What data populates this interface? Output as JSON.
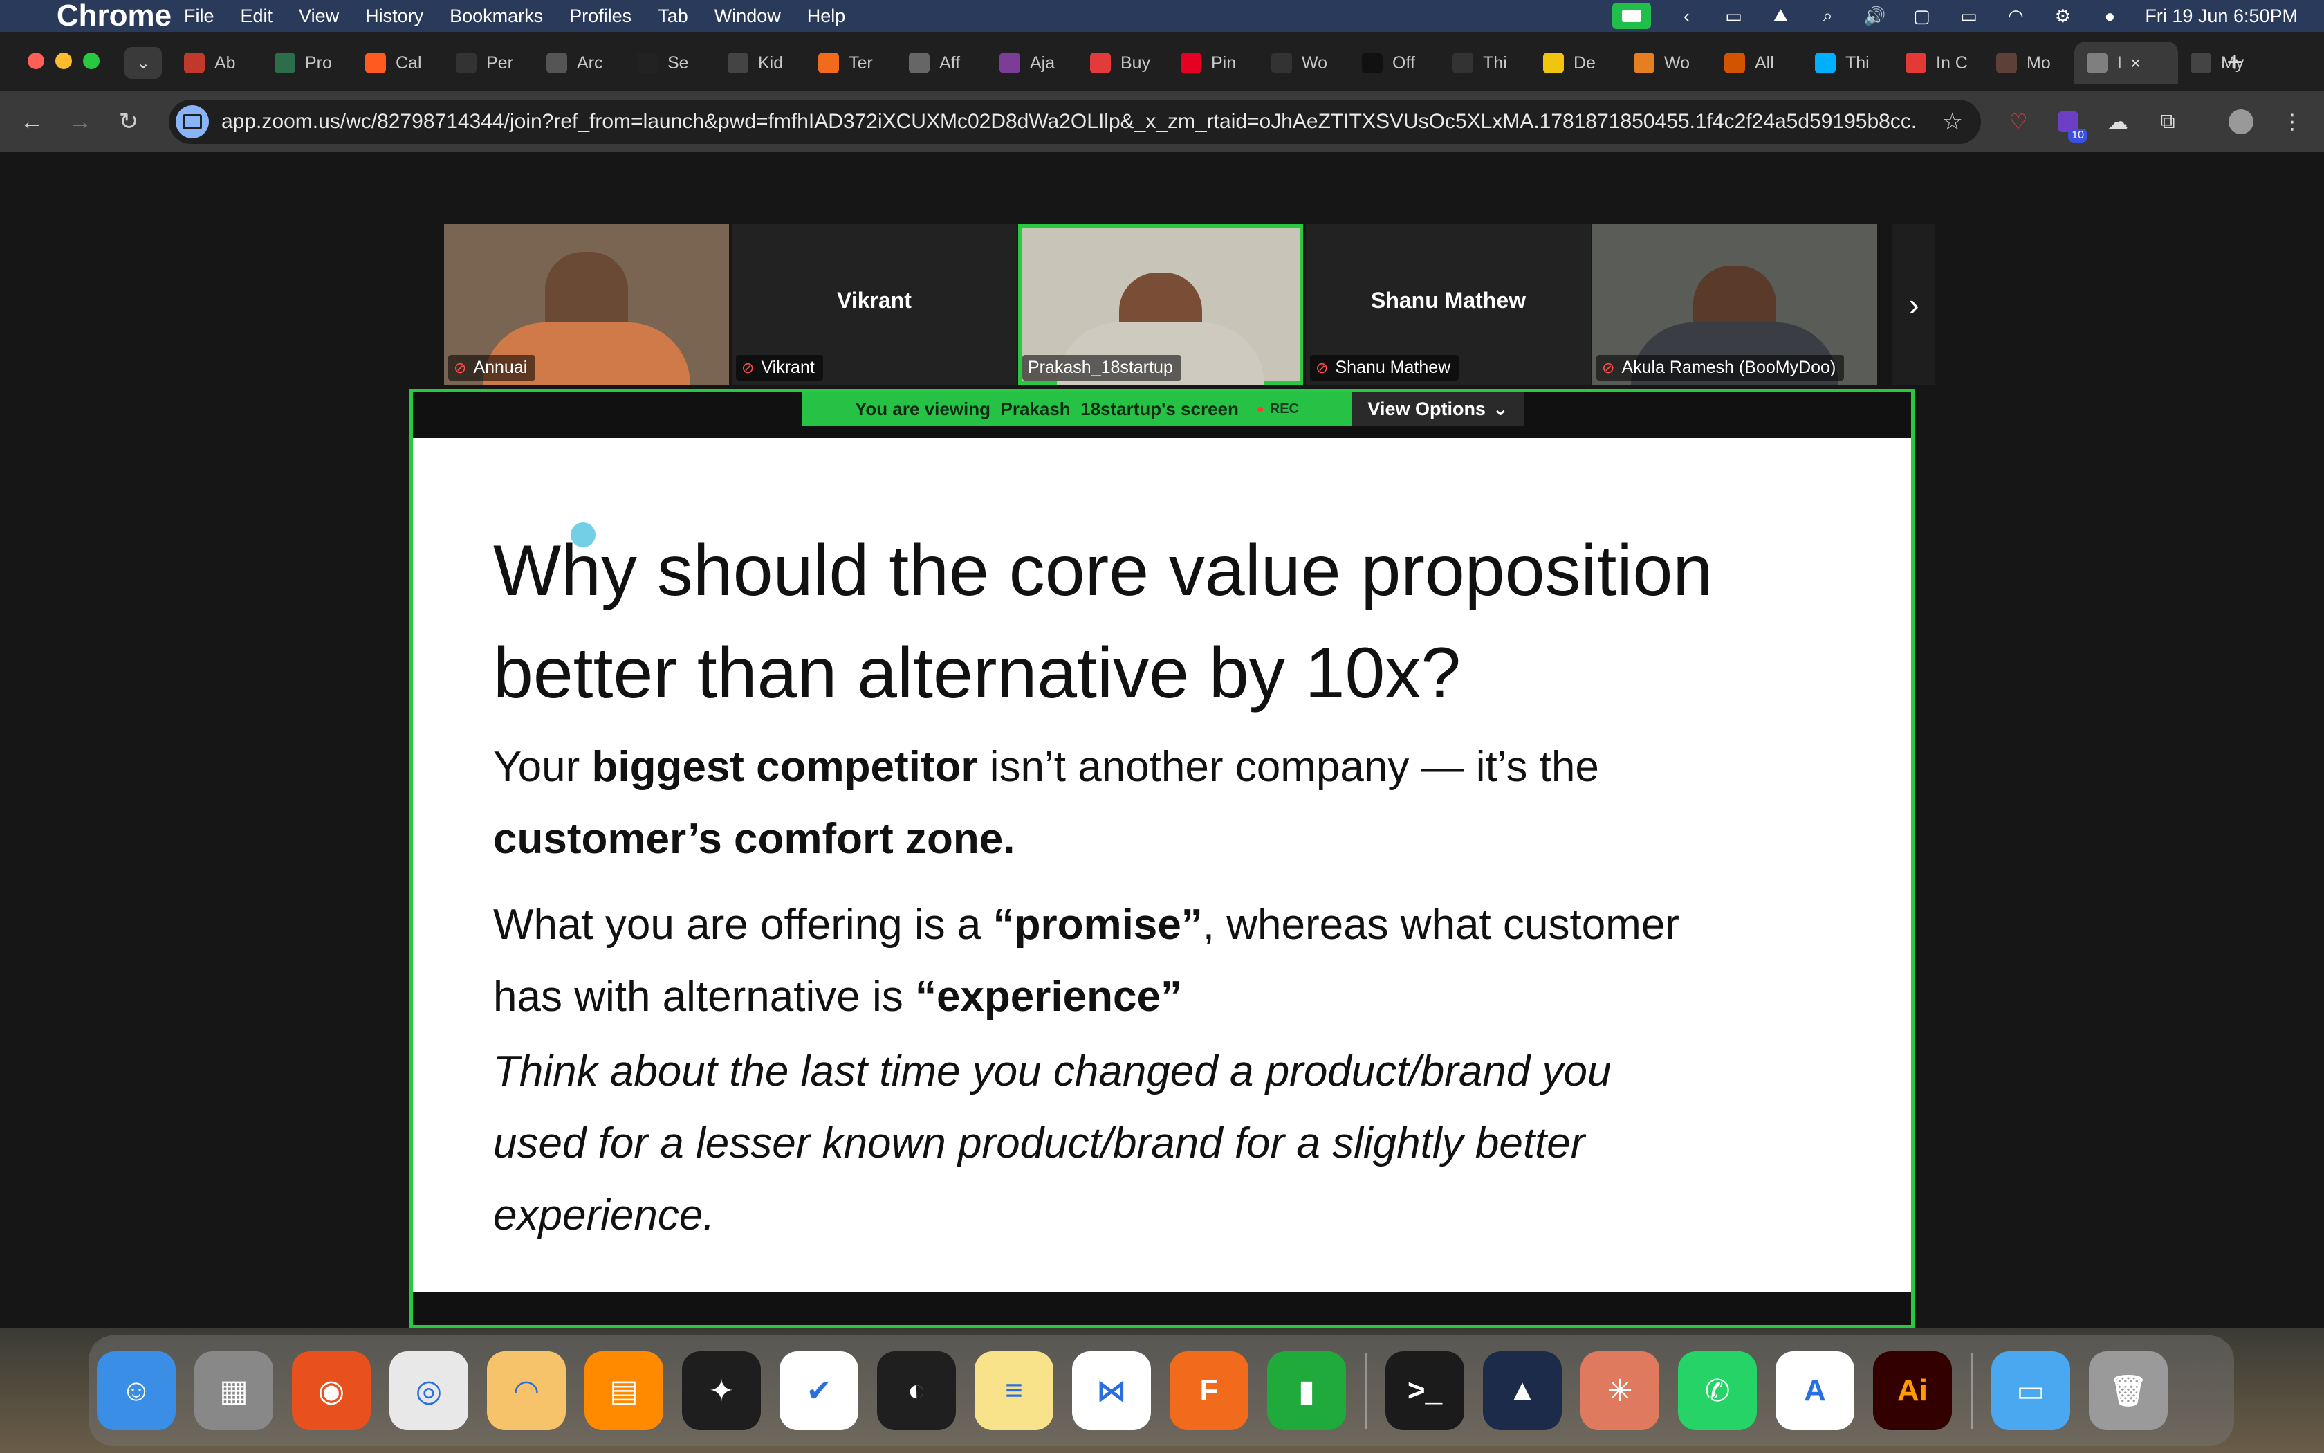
{
  "menubar": {
    "app_name": "Chrome",
    "menus": [
      "File",
      "Edit",
      "View",
      "History",
      "Bookmarks",
      "Profiles",
      "Tab",
      "Window",
      "Help"
    ],
    "datetime": "Fri 19 Jun  6:50PM"
  },
  "tabs": [
    {
      "label": "Ab",
      "color": "#c0392b"
    },
    {
      "label": "Pro",
      "color": "#2c6e49"
    },
    {
      "label": "Cal",
      "color": "#ff5a1f"
    },
    {
      "label": "Per",
      "color": "#333333"
    },
    {
      "label": "Arc",
      "color": "#555555"
    },
    {
      "label": "Se",
      "color": "#222222"
    },
    {
      "label": "Kid",
      "color": "#444444"
    },
    {
      "label": "Ter",
      "color": "#f26b1d"
    },
    {
      "label": "Aff",
      "color": "#666666"
    },
    {
      "label": "Aja",
      "color": "#7d3c98"
    },
    {
      "label": "Buy",
      "color": "#e33b3b"
    },
    {
      "label": "Pin",
      "color": "#e60023"
    },
    {
      "label": "Wo",
      "color": "#333333"
    },
    {
      "label": "Off",
      "color": "#111111"
    },
    {
      "label": "Thi",
      "color": "#333333"
    },
    {
      "label": "De",
      "color": "#f1c40f"
    },
    {
      "label": "Wo",
      "color": "#e67e22"
    },
    {
      "label": "All",
      "color": "#d35400"
    },
    {
      "label": "Thi",
      "color": "#00b0ff"
    },
    {
      "label": "In C",
      "color": "#e53935"
    },
    {
      "label": "Mo",
      "color": "#5d4037"
    },
    {
      "label": "I",
      "color": "#7f7f7f",
      "active": true
    },
    {
      "label": "My",
      "color": "#444444"
    }
  ],
  "omnibox": {
    "url": "app.zoom.us/wc/82798714344/join?ref_from=launch&pwd=fmfhIAD372iXCUXMc02D8dWa2OLIlp&_x_zm_rtaid=oJhAeZTITXSVUsOc5XLxMA.1781871850455.1f4c2f24a5d59195b8cc..."
  },
  "toolbar": {
    "extension_badge": "10"
  },
  "participants": [
    {
      "name": "Annuai",
      "video": true,
      "muted": true
    },
    {
      "name": "Vikrant",
      "video": false,
      "muted": true
    },
    {
      "name": "Prakash_18startup",
      "video": true,
      "muted": false,
      "speaking": true
    },
    {
      "name": "Shanu Mathew",
      "video": false,
      "muted": true
    },
    {
      "name": "Akula Ramesh (BooMyDoo)",
      "video": true,
      "muted": true
    }
  ],
  "share": {
    "viewing_prefix": "You are viewing",
    "viewing_name": "Prakash_18startup's screen",
    "rec_label": "REC",
    "view_options_label": "View Options"
  },
  "slide": {
    "title_line1": "Why should the core value proposition",
    "title_line2": "better than alternative by 10x?",
    "p1_a": "Your ",
    "p1_b": "biggest competitor",
    "p1_c": " isn’t another company — it’s the",
    "p1_d": "customer’s comfort zone.",
    "p2_a": "What you are offering is a ",
    "p2_b": "“promise”",
    "p2_c": ", whereas what customer",
    "p2_d": "has with alternative is ",
    "p2_e": "“experience”",
    "p3_line1": "Think about the last time you changed a product/brand you",
    "p3_line2": "used for a lesser known product/brand for a slightly better",
    "p3_line3": "experience."
  },
  "dock": [
    {
      "name": "Finder",
      "icon": "finder-icon",
      "color": "#3a8ee6",
      "glyph": "☺"
    },
    {
      "name": "Launchpad",
      "icon": "launchpad-icon",
      "color": "#888888",
      "glyph": "▦"
    },
    {
      "name": "Firefox",
      "icon": "firefox-icon",
      "color": "#e8501e",
      "glyph": "◉"
    },
    {
      "name": "Chrome",
      "icon": "chrome-icon",
      "color": "#e8e8e8",
      "glyph": "◎"
    },
    {
      "name": "Arc",
      "icon": "arc-icon",
      "color": "#f6c36a",
      "glyph": "◠"
    },
    {
      "name": "Books",
      "icon": "books-icon",
      "color": "#ff8a00",
      "glyph": "▤"
    },
    {
      "name": "Figma",
      "icon": "figma-icon",
      "color": "#1e1e1e",
      "glyph": "✦"
    },
    {
      "name": "Tasks",
      "icon": "checkmark-icon",
      "color": "#ffffff",
      "glyph": "✔"
    },
    {
      "name": "Notes",
      "icon": "notes-app-icon",
      "color": "#1f1f1f",
      "glyph": "◐"
    },
    {
      "name": "Stickies",
      "icon": "stickies-icon",
      "color": "#f9e38a",
      "glyph": "≡"
    },
    {
      "name": "VS Code",
      "icon": "vscode-icon",
      "color": "#ffffff",
      "glyph": "⋈"
    },
    {
      "name": "Fusion",
      "icon": "fusion-icon",
      "color": "#f26b1d",
      "glyph": "F"
    },
    {
      "name": "Numbers",
      "icon": "numbers-icon",
      "color": "#1faa3b",
      "glyph": "▮"
    },
    {
      "name": "Terminal",
      "icon": "terminal-icon",
      "color": "#1b1b1b",
      "glyph": ">_"
    },
    {
      "name": "Affinity",
      "icon": "affinity-icon",
      "color": "#1c2b4a",
      "glyph": "▲"
    },
    {
      "name": "Claude",
      "icon": "asterisk-icon",
      "color": "#e07a5f",
      "glyph": "✳"
    },
    {
      "name": "WhatsApp",
      "icon": "whatsapp-icon",
      "color": "#25d366",
      "glyph": "✆"
    },
    {
      "name": "Instruments",
      "icon": "instruments-icon",
      "color": "#ffffff",
      "glyph": "A"
    },
    {
      "name": "Illustrator",
      "icon": "illustrator-icon",
      "color": "#330000",
      "glyph": "Ai"
    },
    {
      "name": "Downloads",
      "icon": "folder-icon",
      "color": "#4aa8f0",
      "glyph": "▭"
    },
    {
      "name": "Trash",
      "icon": "trash-icon",
      "color": "#9a9a9a",
      "glyph": "🗑"
    }
  ]
}
